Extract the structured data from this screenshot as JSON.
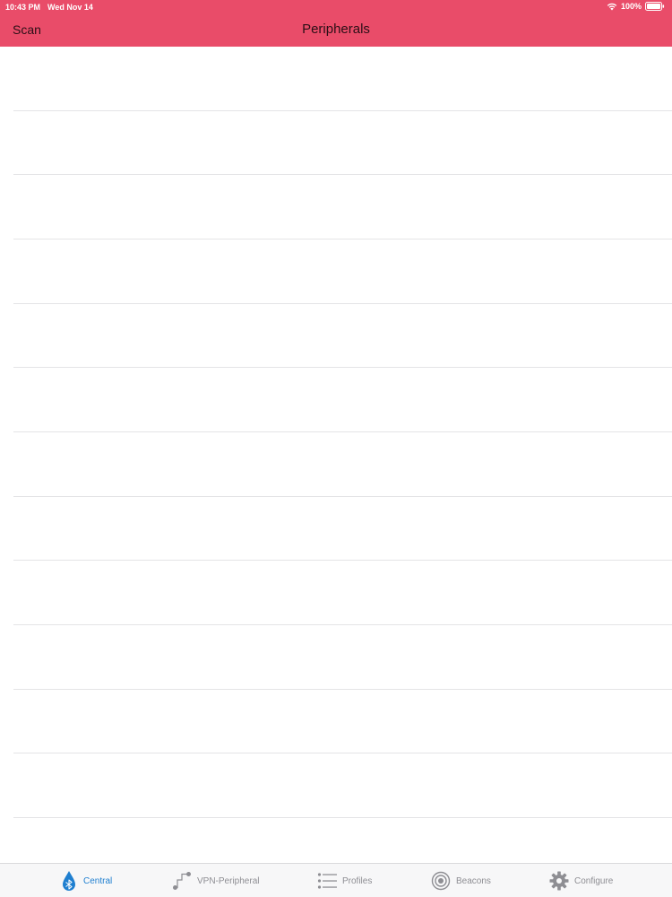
{
  "status_bar": {
    "time": "10:43 PM",
    "date": "Wed Nov 14",
    "battery": "100%",
    "wifi_icon": "wifi-icon",
    "battery_icon": "battery-icon"
  },
  "nav_bar": {
    "left_button": "Scan",
    "title": "Peripherals"
  },
  "list": {
    "row_count": 12
  },
  "tab_bar": {
    "tabs": [
      {
        "label": "Central",
        "icon": "bluetooth-drop-icon",
        "active": true
      },
      {
        "label": "VPN-Peripheral",
        "icon": "peripheral-icon",
        "active": false
      },
      {
        "label": "Profiles",
        "icon": "list-icon",
        "active": false
      },
      {
        "label": "Beacons",
        "icon": "beacon-icon",
        "active": false
      },
      {
        "label": "Configure",
        "icon": "gear-icon",
        "active": false
      }
    ]
  },
  "colors": {
    "nav_background": "#e94c69",
    "active_tab": "#1f7fd0",
    "inactive_tab": "#8e8e93"
  }
}
